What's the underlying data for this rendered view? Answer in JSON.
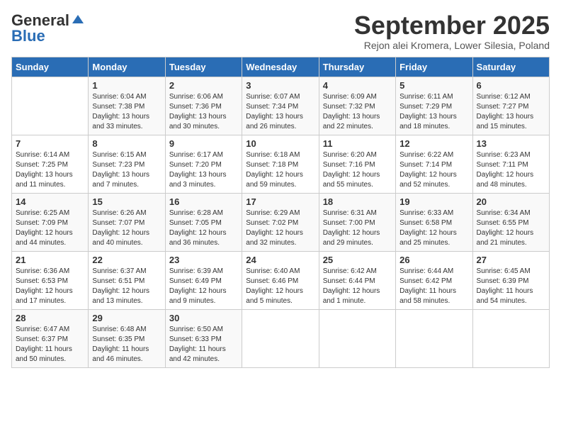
{
  "logo": {
    "line1": "General",
    "line2": "Blue"
  },
  "title": "September 2025",
  "subtitle": "Rejon alei Kromera, Lower Silesia, Poland",
  "days_of_week": [
    "Sunday",
    "Monday",
    "Tuesday",
    "Wednesday",
    "Thursday",
    "Friday",
    "Saturday"
  ],
  "weeks": [
    [
      {
        "day": "",
        "info": ""
      },
      {
        "day": "1",
        "info": "Sunrise: 6:04 AM\nSunset: 7:38 PM\nDaylight: 13 hours\nand 33 minutes."
      },
      {
        "day": "2",
        "info": "Sunrise: 6:06 AM\nSunset: 7:36 PM\nDaylight: 13 hours\nand 30 minutes."
      },
      {
        "day": "3",
        "info": "Sunrise: 6:07 AM\nSunset: 7:34 PM\nDaylight: 13 hours\nand 26 minutes."
      },
      {
        "day": "4",
        "info": "Sunrise: 6:09 AM\nSunset: 7:32 PM\nDaylight: 13 hours\nand 22 minutes."
      },
      {
        "day": "5",
        "info": "Sunrise: 6:11 AM\nSunset: 7:29 PM\nDaylight: 13 hours\nand 18 minutes."
      },
      {
        "day": "6",
        "info": "Sunrise: 6:12 AM\nSunset: 7:27 PM\nDaylight: 13 hours\nand 15 minutes."
      }
    ],
    [
      {
        "day": "7",
        "info": "Sunrise: 6:14 AM\nSunset: 7:25 PM\nDaylight: 13 hours\nand 11 minutes."
      },
      {
        "day": "8",
        "info": "Sunrise: 6:15 AM\nSunset: 7:23 PM\nDaylight: 13 hours\nand 7 minutes."
      },
      {
        "day": "9",
        "info": "Sunrise: 6:17 AM\nSunset: 7:20 PM\nDaylight: 13 hours\nand 3 minutes."
      },
      {
        "day": "10",
        "info": "Sunrise: 6:18 AM\nSunset: 7:18 PM\nDaylight: 12 hours\nand 59 minutes."
      },
      {
        "day": "11",
        "info": "Sunrise: 6:20 AM\nSunset: 7:16 PM\nDaylight: 12 hours\nand 55 minutes."
      },
      {
        "day": "12",
        "info": "Sunrise: 6:22 AM\nSunset: 7:14 PM\nDaylight: 12 hours\nand 52 minutes."
      },
      {
        "day": "13",
        "info": "Sunrise: 6:23 AM\nSunset: 7:11 PM\nDaylight: 12 hours\nand 48 minutes."
      }
    ],
    [
      {
        "day": "14",
        "info": "Sunrise: 6:25 AM\nSunset: 7:09 PM\nDaylight: 12 hours\nand 44 minutes."
      },
      {
        "day": "15",
        "info": "Sunrise: 6:26 AM\nSunset: 7:07 PM\nDaylight: 12 hours\nand 40 minutes."
      },
      {
        "day": "16",
        "info": "Sunrise: 6:28 AM\nSunset: 7:05 PM\nDaylight: 12 hours\nand 36 minutes."
      },
      {
        "day": "17",
        "info": "Sunrise: 6:29 AM\nSunset: 7:02 PM\nDaylight: 12 hours\nand 32 minutes."
      },
      {
        "day": "18",
        "info": "Sunrise: 6:31 AM\nSunset: 7:00 PM\nDaylight: 12 hours\nand 29 minutes."
      },
      {
        "day": "19",
        "info": "Sunrise: 6:33 AM\nSunset: 6:58 PM\nDaylight: 12 hours\nand 25 minutes."
      },
      {
        "day": "20",
        "info": "Sunrise: 6:34 AM\nSunset: 6:55 PM\nDaylight: 12 hours\nand 21 minutes."
      }
    ],
    [
      {
        "day": "21",
        "info": "Sunrise: 6:36 AM\nSunset: 6:53 PM\nDaylight: 12 hours\nand 17 minutes."
      },
      {
        "day": "22",
        "info": "Sunrise: 6:37 AM\nSunset: 6:51 PM\nDaylight: 12 hours\nand 13 minutes."
      },
      {
        "day": "23",
        "info": "Sunrise: 6:39 AM\nSunset: 6:49 PM\nDaylight: 12 hours\nand 9 minutes."
      },
      {
        "day": "24",
        "info": "Sunrise: 6:40 AM\nSunset: 6:46 PM\nDaylight: 12 hours\nand 5 minutes."
      },
      {
        "day": "25",
        "info": "Sunrise: 6:42 AM\nSunset: 6:44 PM\nDaylight: 12 hours\nand 1 minute."
      },
      {
        "day": "26",
        "info": "Sunrise: 6:44 AM\nSunset: 6:42 PM\nDaylight: 11 hours\nand 58 minutes."
      },
      {
        "day": "27",
        "info": "Sunrise: 6:45 AM\nSunset: 6:39 PM\nDaylight: 11 hours\nand 54 minutes."
      }
    ],
    [
      {
        "day": "28",
        "info": "Sunrise: 6:47 AM\nSunset: 6:37 PM\nDaylight: 11 hours\nand 50 minutes."
      },
      {
        "day": "29",
        "info": "Sunrise: 6:48 AM\nSunset: 6:35 PM\nDaylight: 11 hours\nand 46 minutes."
      },
      {
        "day": "30",
        "info": "Sunrise: 6:50 AM\nSunset: 6:33 PM\nDaylight: 11 hours\nand 42 minutes."
      },
      {
        "day": "",
        "info": ""
      },
      {
        "day": "",
        "info": ""
      },
      {
        "day": "",
        "info": ""
      },
      {
        "day": "",
        "info": ""
      }
    ]
  ]
}
